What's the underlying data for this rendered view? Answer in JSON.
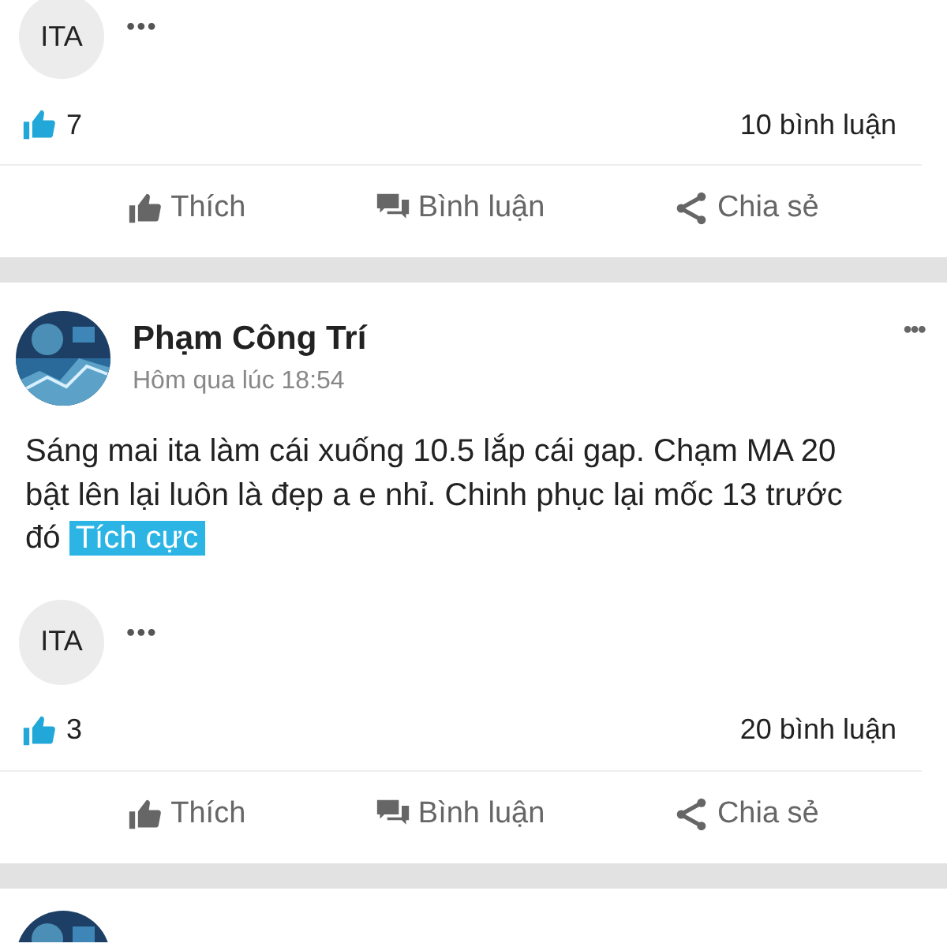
{
  "posts": [
    {
      "kind": "partial",
      "chip": "ITA",
      "more": "•••",
      "likes": "7",
      "comments": "10 bình luận",
      "actions": [
        {
          "kind": "like",
          "label": "Thích"
        },
        {
          "kind": "comment",
          "label": "Bình luận"
        },
        {
          "kind": "share",
          "label": "Chia sẻ"
        }
      ]
    },
    {
      "kind": "full",
      "author": "Phạm Công Trí",
      "time": "Hôm qua lúc 18:54",
      "menu": "•••",
      "body": "Sáng mai ita làm cái xuống 10.5 lắp cái gap. Chạm MA 20 bật lên lại luôn là đẹp a e nhỉ. Chinh phục lại mốc 13 trước đó",
      "tag": "Tích cực",
      "chip": "ITA",
      "more": "•••",
      "likes": "3",
      "comments": "20 bình luận",
      "actions": [
        {
          "kind": "like",
          "label": "Thích"
        },
        {
          "kind": "comment",
          "label": "Bình luận"
        },
        {
          "kind": "share",
          "label": "Chia sẻ"
        }
      ]
    },
    {
      "kind": "next"
    }
  ]
}
